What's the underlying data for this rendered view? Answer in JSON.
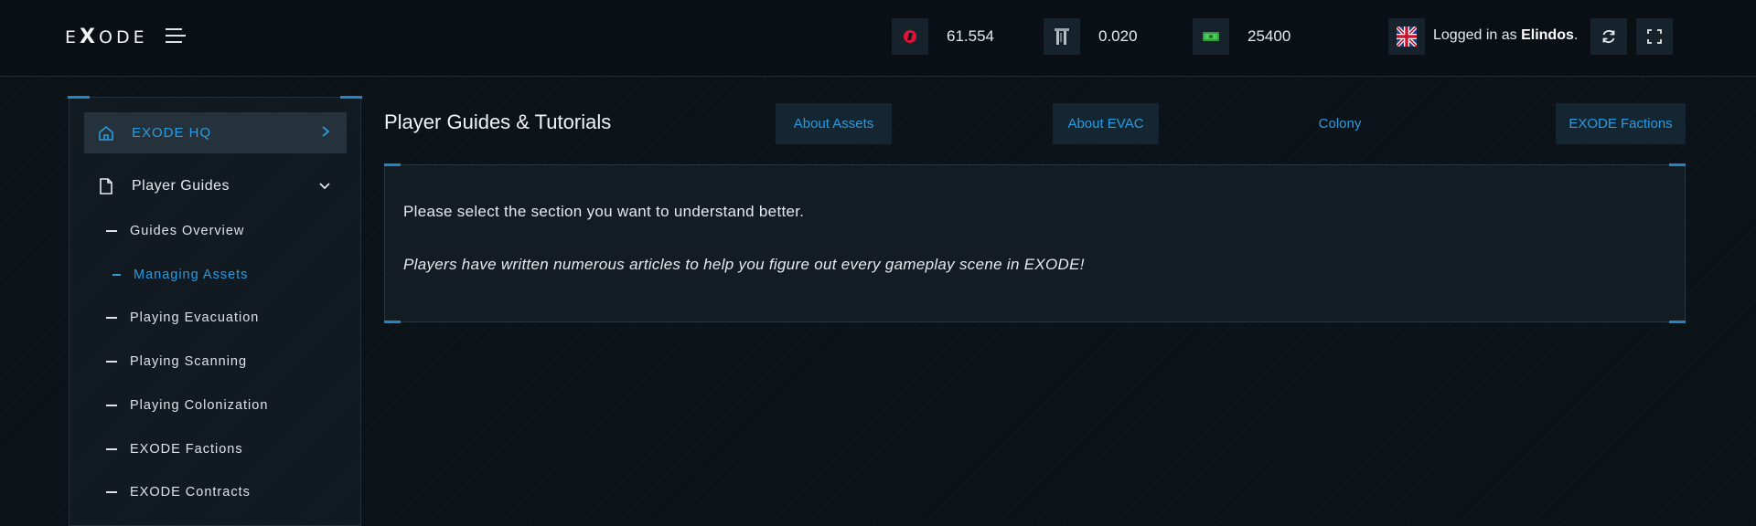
{
  "header": {
    "logo": {
      "pre": "E",
      "x": "X",
      "post": "ODE"
    },
    "currencies": [
      {
        "name": "hive",
        "icon": "hive-icon",
        "value": "61.554",
        "color": "#e31337"
      },
      {
        "name": "evac",
        "icon": "evac-token-icon",
        "value": "0.020"
      },
      {
        "name": "dollar",
        "icon": "cash-icon",
        "value": "25400",
        "color": "#39b54a"
      }
    ],
    "login_prefix": "Logged in as",
    "username": "Elindos",
    "username_suffix": "."
  },
  "sidebar": {
    "hq_label": "EXODE HQ",
    "guides_label": "Player Guides",
    "items": [
      {
        "label": "Guides Overview",
        "active": false
      },
      {
        "label": "Managing Assets",
        "active": true
      },
      {
        "label": "Playing Evacuation",
        "active": false
      },
      {
        "label": "Playing Scanning",
        "active": false
      },
      {
        "label": "Playing Colonization",
        "active": false
      },
      {
        "label": "EXODE Factions",
        "active": false
      },
      {
        "label": "EXODE Contracts",
        "active": false
      }
    ]
  },
  "main": {
    "title": "Player Guides & Tutorials",
    "tabs": [
      {
        "label": "About Assets"
      },
      {
        "label": "About EVAC"
      },
      {
        "label": "Colony"
      },
      {
        "label": "EXODE Factions"
      }
    ],
    "intro": "Please select the section you want to understand better.",
    "note": "Players have written numerous articles to help you figure out every gameplay scene in EXODE!"
  },
  "colors": {
    "accent": "#2a9be0",
    "background": "#0b1319"
  }
}
